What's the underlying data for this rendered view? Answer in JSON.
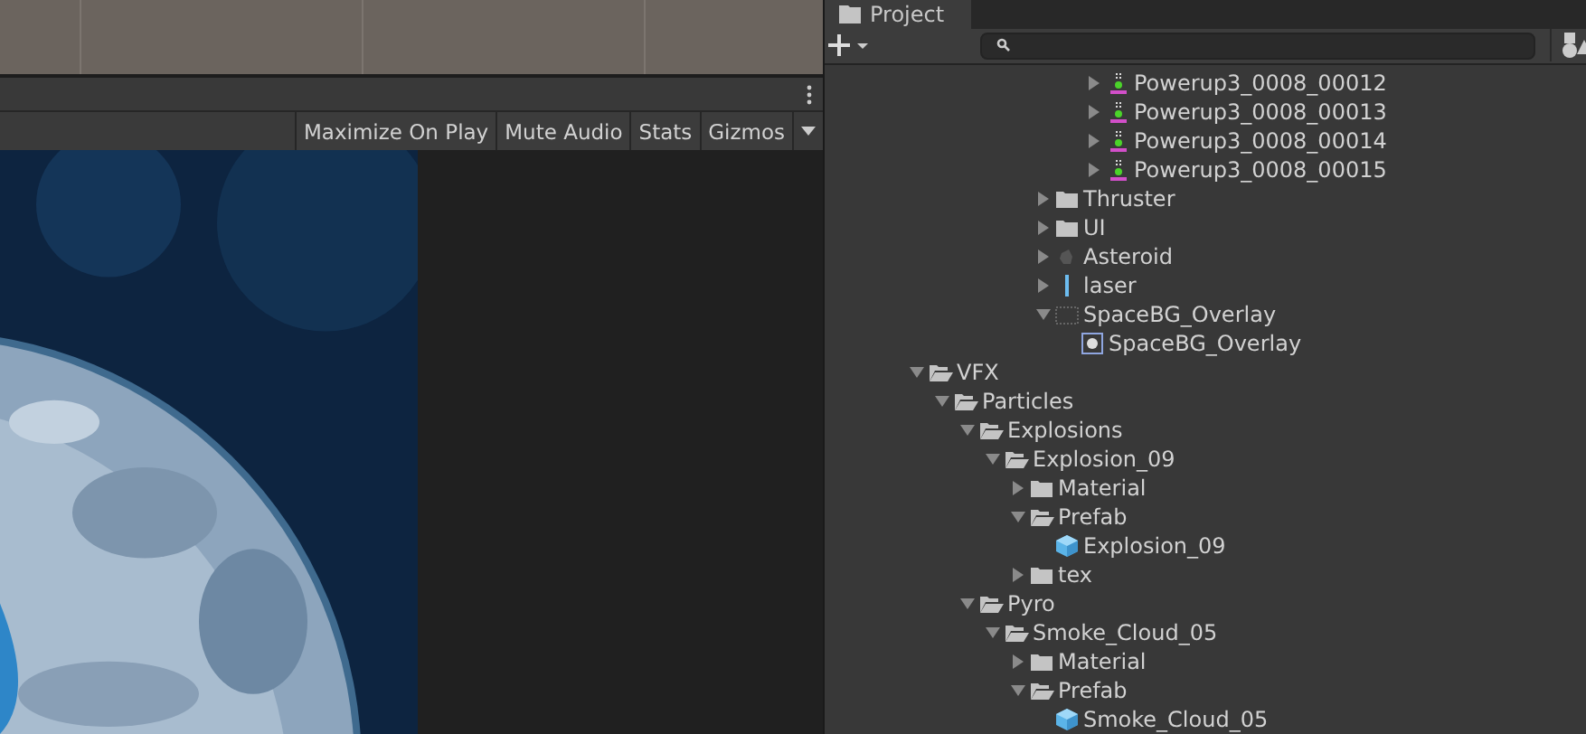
{
  "game_view": {
    "toolbar_buttons": [
      {
        "label": "Maximize On Play",
        "selected": false
      },
      {
        "label": "Mute Audio",
        "selected": false
      },
      {
        "label": "Stats",
        "selected": false
      },
      {
        "label": "Gizmos",
        "selected": false
      }
    ]
  },
  "project": {
    "tab": {
      "label": "Project",
      "selected": true
    },
    "tree": [
      {
        "children": [
          {
            "children": [
              {
                "children": [
                  {
                    "children": [
                      {
                        "children": [
                          {
                            "children": [
                              {
                                "children": [
                                  {
                                    "label": "Powerup3_0008_00012",
                                    "kind": "sprite",
                                    "expanded": false
                                  },
                                  {
                                    "label": "Powerup3_0008_00013",
                                    "kind": "sprite",
                                    "expanded": false
                                  },
                                  {
                                    "label": "Powerup3_0008_00014",
                                    "kind": "sprite",
                                    "expanded": false
                                  },
                                  {
                                    "label": "Powerup3_0008_00015",
                                    "kind": "sprite",
                                    "expanded": false
                                  }
                                ]
                              }
                            ]
                          },
                          {
                            "label": "Thruster",
                            "kind": "folder",
                            "expanded": false
                          },
                          {
                            "label": "UI",
                            "kind": "folder",
                            "expanded": false
                          },
                          {
                            "label": "Asteroid",
                            "kind": "model",
                            "expanded": false
                          },
                          {
                            "label": "laser",
                            "kind": "line",
                            "expanded": false
                          },
                          {
                            "label": "SpaceBG_Overlay",
                            "kind": "texture",
                            "expanded": true,
                            "children": [
                              {
                                "label": "SpaceBG_Overlay",
                                "kind": "sprite-asset"
                              }
                            ]
                          }
                        ]
                      }
                    ]
                  }
                ]
              }
            ]
          }
        ]
      },
      {
        "label": "VFX",
        "kind": "folder",
        "expanded": true,
        "children": [
          {
            "label": "Particles",
            "kind": "folder",
            "expanded": true,
            "children": [
              {
                "label": "Explosions",
                "kind": "folder",
                "expanded": true,
                "children": [
                  {
                    "label": "Explosion_09",
                    "kind": "folder",
                    "expanded": true,
                    "children": [
                      {
                        "label": "Material",
                        "kind": "folder",
                        "expanded": false
                      },
                      {
                        "label": "Prefab",
                        "kind": "folder",
                        "expanded": true,
                        "children": [
                          {
                            "label": "Explosion_09",
                            "kind": "prefab"
                          }
                        ]
                      },
                      {
                        "label": "tex",
                        "kind": "folder",
                        "expanded": false
                      }
                    ]
                  }
                ]
              },
              {
                "label": "Pyro",
                "kind": "folder",
                "expanded": true,
                "children": [
                  {
                    "label": "Smoke_Cloud_05",
                    "kind": "folder",
                    "expanded": true,
                    "children": [
                      {
                        "label": "Material",
                        "kind": "folder",
                        "expanded": false
                      },
                      {
                        "label": "Prefab",
                        "kind": "folder",
                        "expanded": true,
                        "children": [
                          {
                            "label": "Smoke_Cloud_05",
                            "kind": "prefab"
                          }
                        ]
                      }
                    ]
                  }
                ]
              }
            ]
          }
        ]
      }
    ]
  }
}
